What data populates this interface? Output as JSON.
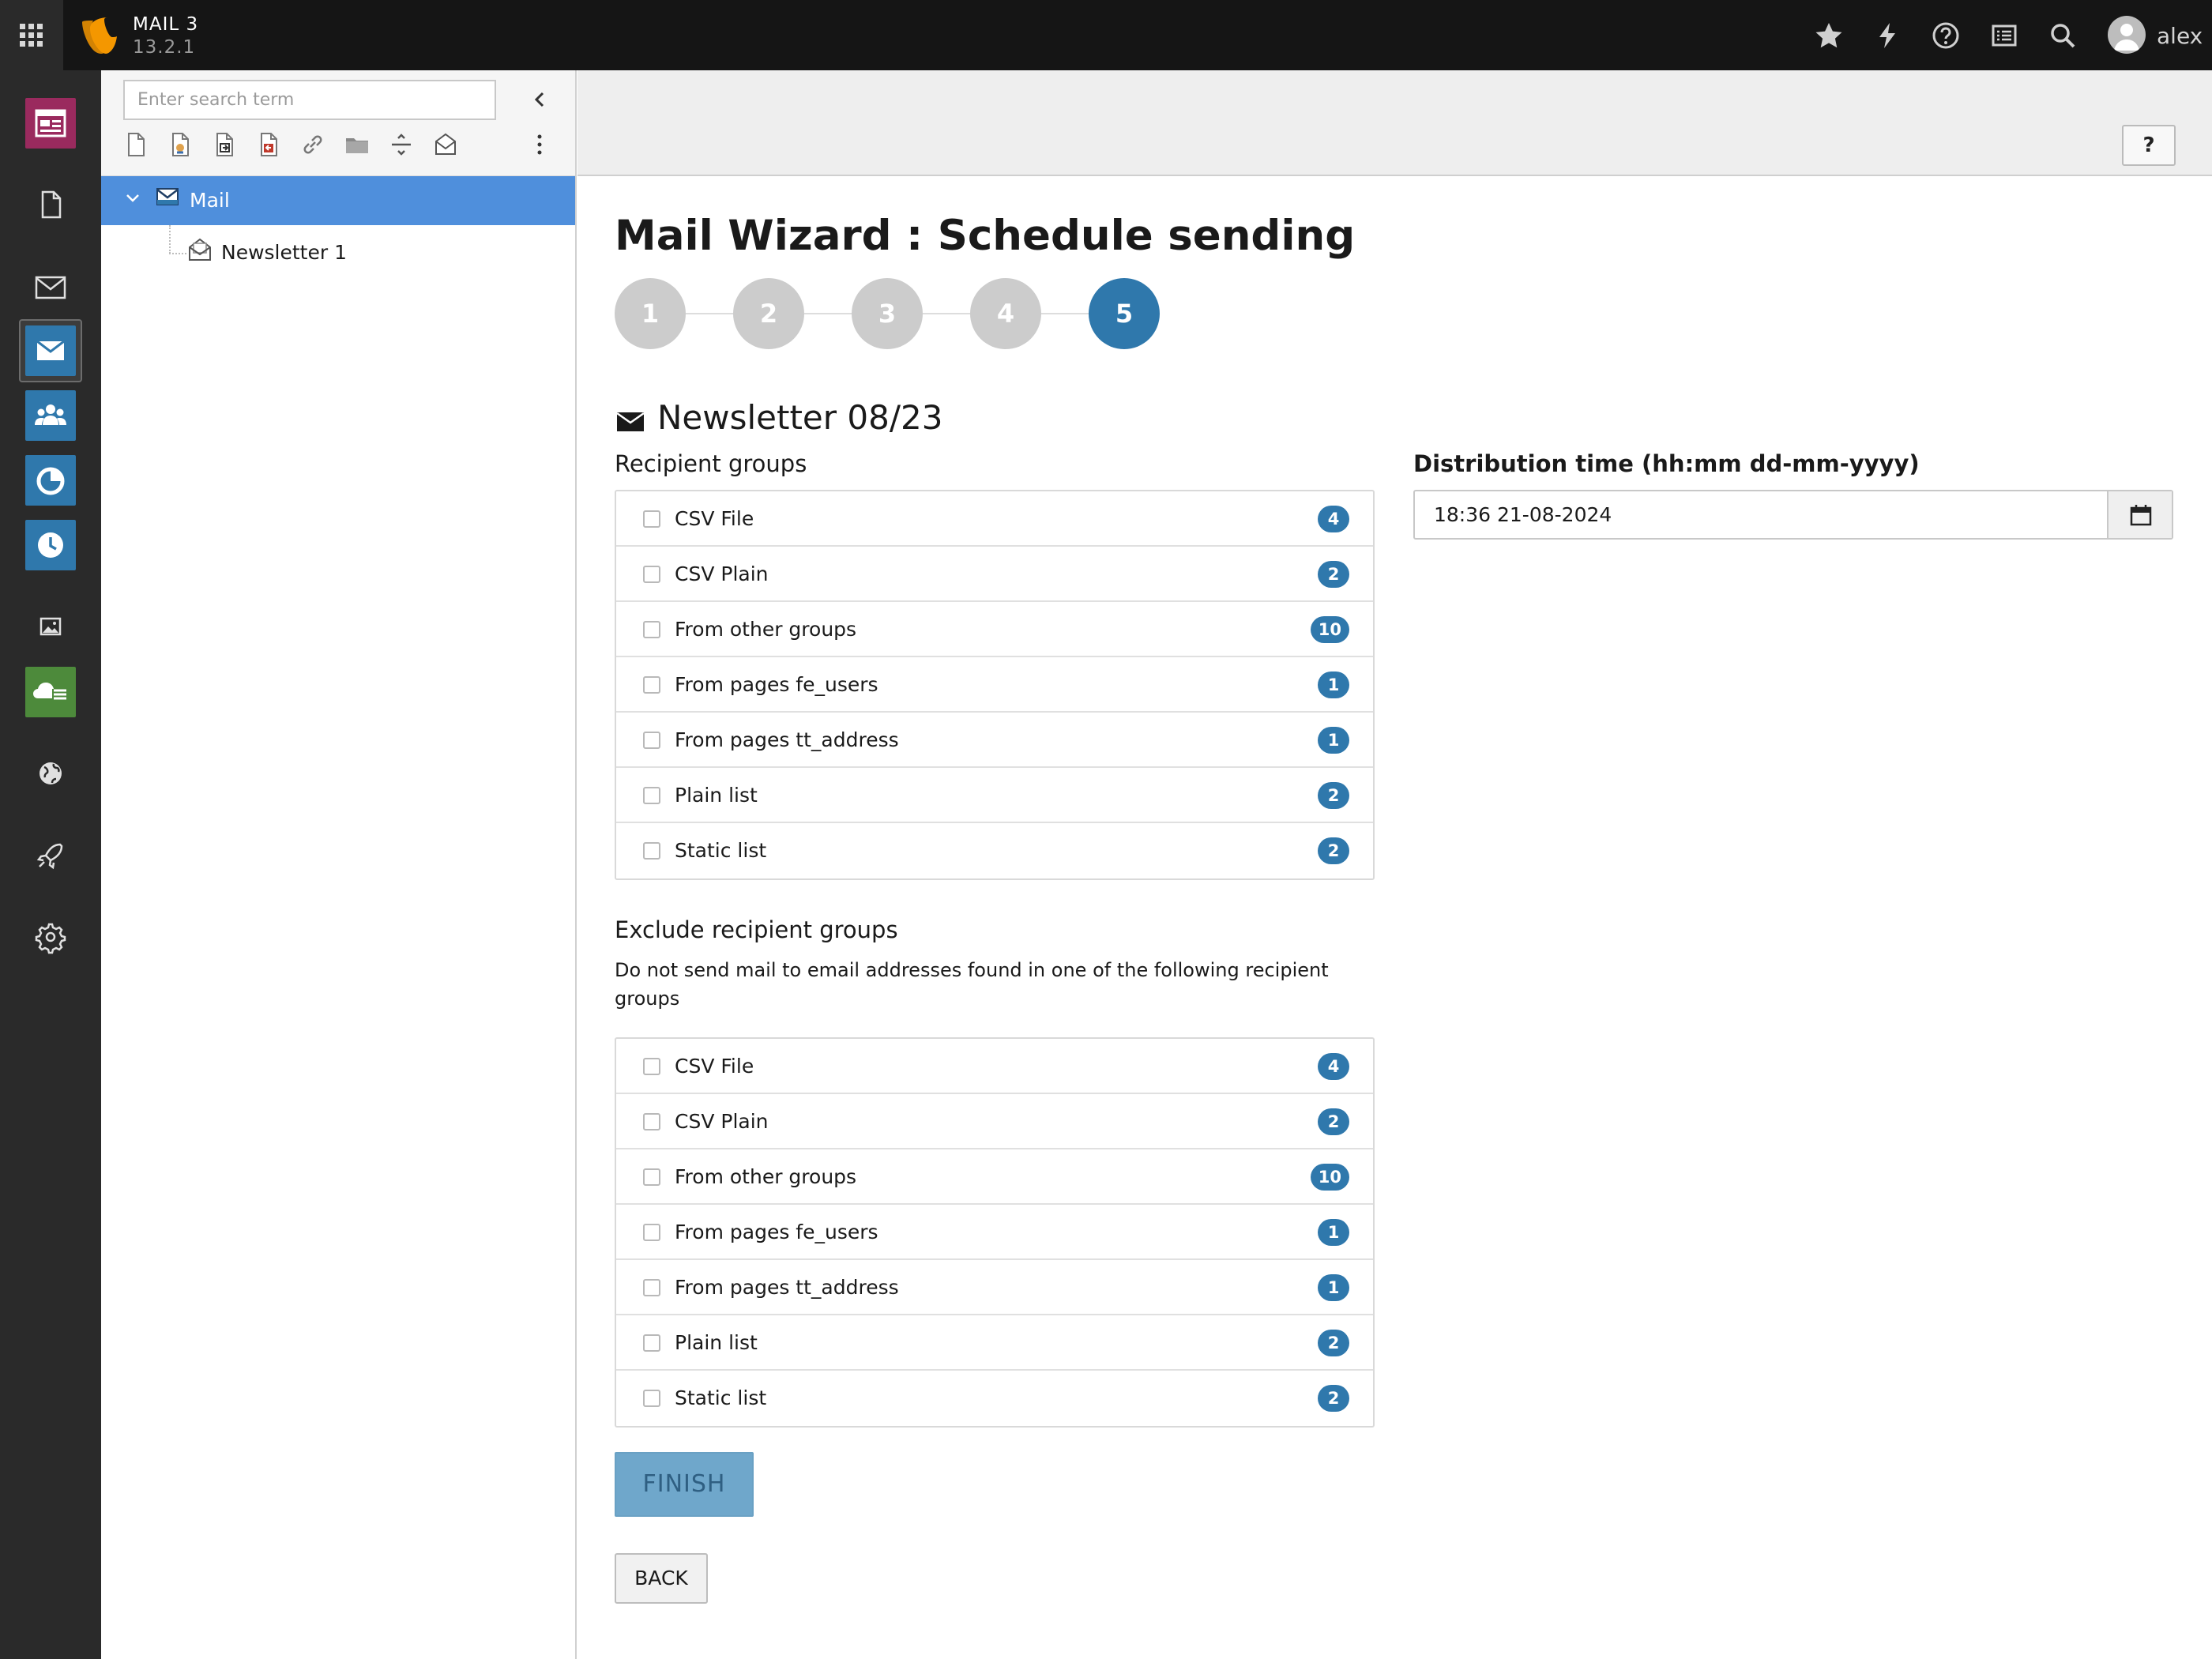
{
  "app": {
    "name": "MAIL 3",
    "version": "13.2.1",
    "user": "alex"
  },
  "colors": {
    "accent": "#2f78ac",
    "tree_selected": "#4f8fdc",
    "finish": "#6fa7cb",
    "topbar": "#151515",
    "module_bar": "#2a2a2a"
  },
  "modules": [
    {
      "icon": "web-layout-icon",
      "color": "#9a2a5e"
    },
    {
      "icon": "page-icon"
    },
    {
      "icon": "mail-outline-icon"
    },
    {
      "icon": "mail-icon",
      "color": "#2f78ac",
      "active": true
    },
    {
      "icon": "users-icon",
      "color": "#2f78ac"
    },
    {
      "icon": "pie-chart-icon",
      "color": "#2f78ac"
    },
    {
      "icon": "clock-icon",
      "color": "#2f78ac"
    },
    {
      "icon": "image-icon"
    },
    {
      "icon": "cloud-list-icon",
      "color": "#4d8a3b"
    },
    {
      "icon": "globe-icon"
    },
    {
      "icon": "rocket-icon"
    },
    {
      "icon": "gear-icon"
    }
  ],
  "tree": {
    "search_placeholder": "Enter search term",
    "toolbar_icons": [
      "new-page-icon",
      "new-shortcut-icon",
      "new-mount-icon",
      "new-external-icon",
      "link-icon",
      "folder-icon",
      "separator-icon",
      "mail-page-icon"
    ],
    "nodes": [
      {
        "label": "Mail",
        "selected": true,
        "expanded": true
      },
      {
        "label": "Newsletter 1"
      }
    ]
  },
  "header": {
    "help_label": "?"
  },
  "wizard": {
    "title": "Mail Wizard : Schedule sending",
    "steps": [
      "1",
      "2",
      "3",
      "4",
      "5"
    ],
    "active_step": 5
  },
  "newsletter": {
    "title": "Newsletter 08/23"
  },
  "recipient_groups": {
    "label": "Recipient groups",
    "items": [
      {
        "label": "CSV File",
        "count": "4",
        "checked": false
      },
      {
        "label": "CSV Plain",
        "count": "2",
        "checked": false
      },
      {
        "label": "From other groups",
        "count": "10",
        "checked": false
      },
      {
        "label": "From pages fe_users",
        "count": "1",
        "checked": false
      },
      {
        "label": "From pages tt_address",
        "count": "1",
        "checked": false
      },
      {
        "label": "Plain list",
        "count": "2",
        "checked": false
      },
      {
        "label": "Static list",
        "count": "2",
        "checked": false
      }
    ]
  },
  "exclude_groups": {
    "label": "Exclude recipient groups",
    "description": "Do not send mail to email addresses found in one of the following recipient groups",
    "items": [
      {
        "label": "CSV File",
        "count": "4",
        "checked": false
      },
      {
        "label": "CSV Plain",
        "count": "2",
        "checked": false
      },
      {
        "label": "From other groups",
        "count": "10",
        "checked": false
      },
      {
        "label": "From pages fe_users",
        "count": "1",
        "checked": false
      },
      {
        "label": "From pages tt_address",
        "count": "1",
        "checked": false
      },
      {
        "label": "Plain list",
        "count": "2",
        "checked": false
      },
      {
        "label": "Static list",
        "count": "2",
        "checked": false
      }
    ]
  },
  "distribution": {
    "label": "Distribution time (hh:mm dd-mm-yyyy)",
    "value": "18:36 21-08-2024"
  },
  "buttons": {
    "finish": "FINISH",
    "back": "BACK"
  }
}
